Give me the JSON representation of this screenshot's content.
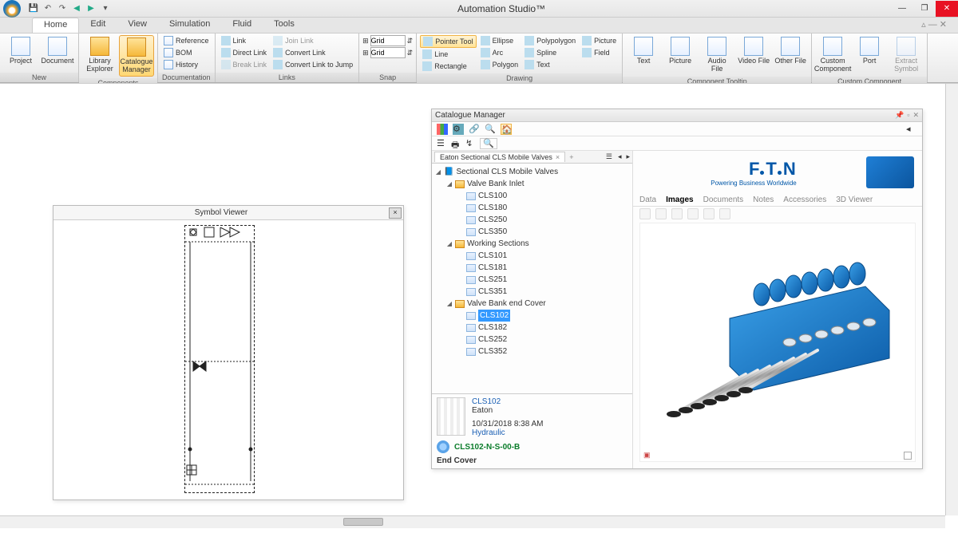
{
  "app": {
    "title": "Automation Studio™"
  },
  "qat_icons": [
    "save",
    "undo",
    "redo",
    "refresh",
    "help",
    "arrow1",
    "arrow2"
  ],
  "menu": {
    "tabs": [
      "Home",
      "Edit",
      "View",
      "Simulation",
      "Fluid",
      "Tools"
    ],
    "active": "Home"
  },
  "ribbon": {
    "groups": [
      {
        "title": "New",
        "big": [
          {
            "label": "Project",
            "icon": "icon-doc"
          },
          {
            "label": "Document",
            "icon": "icon-doc"
          }
        ]
      },
      {
        "title": "Components",
        "big": [
          {
            "label": "Library Explorer",
            "icon": "icon-fold"
          },
          {
            "label": "Catalogue Manager",
            "icon": "icon-fold",
            "selected": true
          }
        ]
      },
      {
        "title": "Documentation",
        "small": [
          {
            "label": "Reference"
          },
          {
            "label": "BOM"
          },
          {
            "label": "History"
          }
        ]
      },
      {
        "title": "Links",
        "cols": [
          [
            {
              "label": "Link"
            },
            {
              "label": "Direct Link"
            },
            {
              "label": "Break Link",
              "muted": true
            }
          ],
          [
            {
              "label": "Join Link",
              "muted": true
            },
            {
              "label": "Convert Link"
            },
            {
              "label": "Convert Link to Jump"
            }
          ]
        ]
      },
      {
        "title": "Snap",
        "snap": [
          {
            "label": "Grid",
            "value": ""
          },
          {
            "label": "Grid",
            "value": ""
          }
        ]
      },
      {
        "title": "Drawing",
        "cols": [
          [
            {
              "label": "Pointer Tool",
              "lit": true
            },
            {
              "label": "Line"
            },
            {
              "label": "Rectangle"
            }
          ],
          [
            {
              "label": "Ellipse"
            },
            {
              "label": "Arc"
            },
            {
              "label": "Polygon"
            }
          ],
          [
            {
              "label": "Polypolygon"
            },
            {
              "label": "Spline"
            },
            {
              "label": "Text"
            }
          ],
          [
            {
              "label": "Picture"
            },
            {
              "label": "Field"
            }
          ]
        ]
      },
      {
        "title": "Component Tooltip",
        "big": [
          {
            "label": "Text"
          },
          {
            "label": "Picture"
          },
          {
            "label": "Audio File"
          },
          {
            "label": "Video File"
          },
          {
            "label": "Other File"
          }
        ]
      },
      {
        "title": "Custom Component",
        "big": [
          {
            "label": "Custom Component"
          },
          {
            "label": "Port"
          },
          {
            "label": "Extract Symbol",
            "muted": true
          }
        ]
      }
    ]
  },
  "symbol_viewer": {
    "title": "Symbol Viewer"
  },
  "catalogue": {
    "title": "Catalogue Manager",
    "tab": {
      "label": "Eaton Sectional CLS Mobile Valves"
    },
    "tree": {
      "root": "Sectional CLS Mobile Valves",
      "groups": [
        {
          "name": "Valve Bank Inlet",
          "items": [
            "CLS100",
            "CLS180",
            "CLS250",
            "CLS350"
          ]
        },
        {
          "name": "Working Sections",
          "items": [
            "CLS101",
            "CLS181",
            "CLS251",
            "CLS351"
          ]
        },
        {
          "name": "Valve Bank end Cover",
          "items": [
            "CLS102",
            "CLS182",
            "CLS252",
            "CLS352"
          ]
        }
      ],
      "selected": "CLS102"
    },
    "info": {
      "name": "CLS102",
      "maker": "Eaton",
      "date": "10/31/2018 8:38 AM",
      "category": "Hydraulic",
      "variant": "CLS102-N-S-00-B",
      "desc": "End Cover"
    },
    "brand": {
      "name": "E·T·N",
      "tagline": "Powering Business Worldwide"
    },
    "detail_tabs": [
      "Data",
      "Images",
      "Documents",
      "Notes",
      "Accessories",
      "3D Viewer"
    ],
    "detail_active": "Images"
  }
}
